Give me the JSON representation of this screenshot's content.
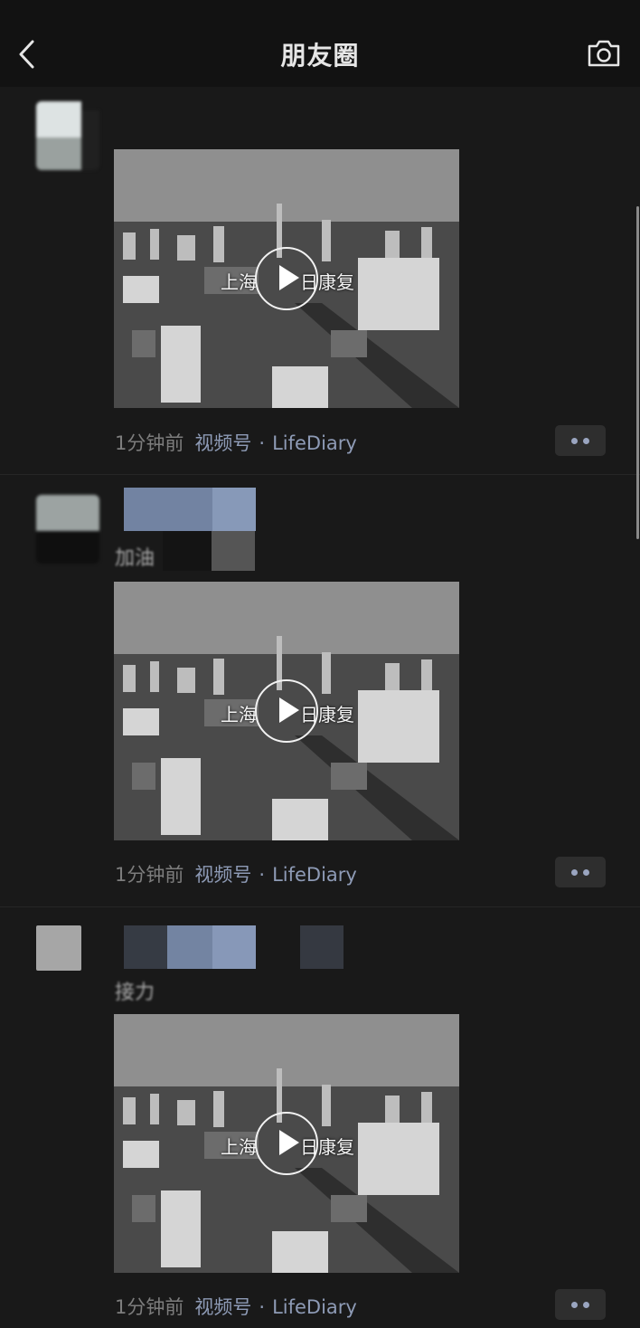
{
  "header": {
    "title": "朋友圈",
    "back_icon": "chevron-left-icon",
    "camera_icon": "camera-icon"
  },
  "posts": [
    {
      "caption": "",
      "video": {
        "overlay_left": "上海",
        "overlay_right": "日康复"
      },
      "time": "1分钟前",
      "channel_label": "视频号",
      "separator": "·",
      "channel_name": "LifeDiary"
    },
    {
      "caption": "加油",
      "video": {
        "overlay_left": "上海",
        "overlay_right": "日康复"
      },
      "time": "1分钟前",
      "channel_label": "视频号",
      "separator": "·",
      "channel_name": "LifeDiary"
    },
    {
      "caption": "接力",
      "video": {
        "overlay_left": "上海",
        "overlay_right": "日康复"
      },
      "time": "1分钟前",
      "channel_label": "视频号",
      "separator": "·",
      "channel_name": "LifeDiary"
    }
  ],
  "colors": {
    "background": "#191919",
    "header": "#121212",
    "link": "#8e9bb6",
    "meta": "#7d7d7d"
  }
}
